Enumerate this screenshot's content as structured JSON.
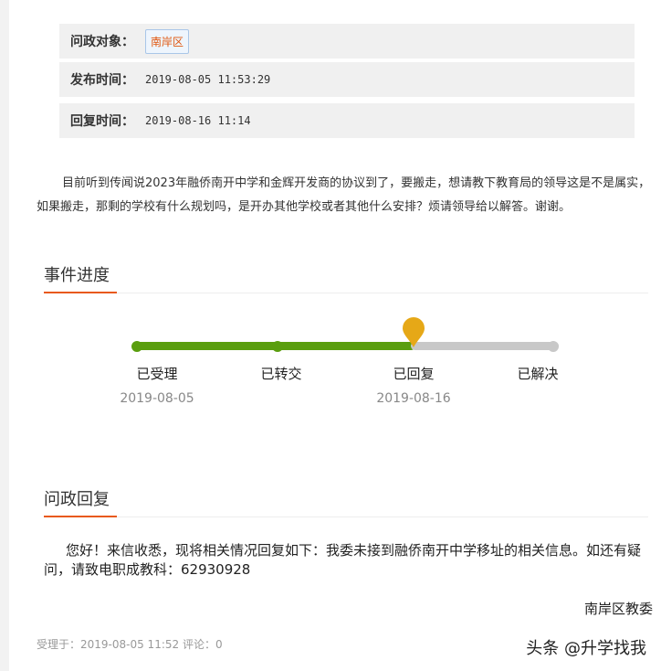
{
  "info": {
    "target_label": "问政对象：",
    "target_value": "南岸区",
    "publish_label": "发布时间：",
    "publish_value": "2019-08-05 11:53:29",
    "reply_label": "回复时间：",
    "reply_value": "2019-08-16 11:14"
  },
  "question": "目前听到传闻说2023年融侨南开中学和金辉开发商的协议到了，要搬走，想请教下教育局的领导这是不是属实，如果搬走，那剩的学校有什么规划吗，是开办其他学校或者其他什么安排？烦请领导给以解答。谢谢。",
  "progress": {
    "title": "事件进度",
    "current_step": 3,
    "steps": [
      {
        "label": "已受理",
        "date": "2019-08-05"
      },
      {
        "label": "已转交",
        "date": ""
      },
      {
        "label": "已回复",
        "date": "2019-08-16"
      },
      {
        "label": "已解决",
        "date": ""
      }
    ],
    "colors": {
      "done": "#5a9e0f",
      "pending": "#c8c8c8",
      "marker": "#e6a817",
      "accent": "#e8591a"
    }
  },
  "reply": {
    "title": "问政回复",
    "text": "您好！来信收悉，现将相关情况回复如下：我委未接到融侨南开中学移址的相关信息。如还有疑问，请致电职成教科：62930928",
    "signature": "南岸区教委"
  },
  "footer": {
    "text": "受理于：2019-08-05 11:52 评论：0",
    "watermark": "头条 @升学找我"
  }
}
